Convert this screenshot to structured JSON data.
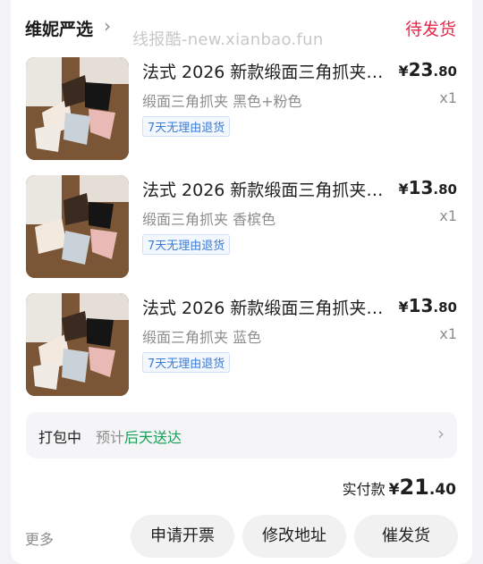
{
  "shop": {
    "name": "维妮严选",
    "chevron": "›"
  },
  "watermark": "线报酷-new.xianbao.fun",
  "order_status": "待发货",
  "status_color": "#e5284a",
  "items": [
    {
      "title": "法式 2026 新款缎面三角抓夹…",
      "price_symbol": "¥",
      "price_int": "23",
      "price_dec": ".80",
      "spec": "缎面三角抓夹 黑色+粉色",
      "qty": "x1",
      "tag": "7天无理由退货"
    },
    {
      "title": "法式 2026 新款缎面三角抓夹…",
      "price_symbol": "¥",
      "price_int": "13",
      "price_dec": ".80",
      "spec": "缎面三角抓夹 香槟色",
      "qty": "x1",
      "tag": "7天无理由退货"
    },
    {
      "title": "法式 2026 新款缎面三角抓夹…",
      "price_symbol": "¥",
      "price_int": "13",
      "price_dec": ".80",
      "spec": "缎面三角抓夹 蓝色",
      "qty": "x1",
      "tag": "7天无理由退货"
    }
  ],
  "logistics": {
    "status": "打包中",
    "estimate_prefix": "预计",
    "estimate_value": "后天送达",
    "estimate_color": "#18a058",
    "chevron": "›"
  },
  "payment": {
    "label": "实付款",
    "symbol": "¥",
    "int": "21",
    "dec": ".40"
  },
  "actions": {
    "more": "更多",
    "invoice": "申请开票",
    "edit_address": "修改地址",
    "urge_shipping": "催发货"
  }
}
